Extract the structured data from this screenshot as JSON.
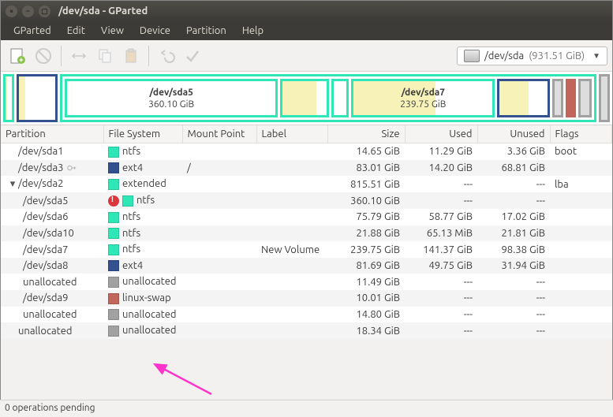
{
  "window": {
    "title": "/dev/sda - GParted"
  },
  "menu": [
    "GParted",
    "Edit",
    "View",
    "Device",
    "Partition",
    "Help"
  ],
  "device_selector": {
    "device": "/dev/sda",
    "size": "(931.51 GiB)"
  },
  "colors": {
    "ntfs": "#2ee6b6",
    "ext4": "#33508f",
    "extended": "#2ee6b6",
    "linux-swap": "#c1665a",
    "unallocated": "#a1a1a1",
    "used_fill": "#f7f2b8"
  },
  "barSegs": {
    "sda5": {
      "label": "/dev/sda5",
      "size": "360.10 GiB"
    },
    "sda7": {
      "label": "/dev/sda7",
      "size": "239.75 GiB"
    }
  },
  "columns": [
    "Partition",
    "File System",
    "Mount Point",
    "Label",
    "Size",
    "Used",
    "Unused",
    "Flags"
  ],
  "rows": [
    {
      "name": "/dev/sda1",
      "key": false,
      "tri": false,
      "warn": false,
      "fs": "ntfs",
      "fscolor": "#2ee6b6",
      "mp": "",
      "label": "",
      "size": "14.65 GiB",
      "used": "11.29 GiB",
      "unused": "3.36 GiB",
      "flags": "boot",
      "indent": 0,
      "alt": false
    },
    {
      "name": "/dev/sda3",
      "key": true,
      "tri": false,
      "warn": false,
      "fs": "ext4",
      "fscolor": "#33508f",
      "mp": "/",
      "label": "",
      "size": "83.01 GiB",
      "used": "14.20 GiB",
      "unused": "68.81 GiB",
      "flags": "",
      "indent": 0,
      "alt": true
    },
    {
      "name": "/dev/sda2",
      "key": false,
      "tri": true,
      "warn": false,
      "fs": "extended",
      "fscolor": "#2ee6b6",
      "mp": "",
      "label": "",
      "size": "815.51 GiB",
      "used": "---",
      "unused": "---",
      "flags": "lba",
      "indent": 0,
      "alt": false
    },
    {
      "name": "/dev/sda5",
      "key": false,
      "tri": false,
      "warn": true,
      "fs": "ntfs",
      "fscolor": "#2ee6b6",
      "mp": "",
      "label": "",
      "size": "360.10 GiB",
      "used": "---",
      "unused": "---",
      "flags": "",
      "indent": 1,
      "alt": true
    },
    {
      "name": "/dev/sda6",
      "key": false,
      "tri": false,
      "warn": false,
      "fs": "ntfs",
      "fscolor": "#2ee6b6",
      "mp": "",
      "label": "",
      "size": "75.79 GiB",
      "used": "58.77 GiB",
      "unused": "17.02 GiB",
      "flags": "",
      "indent": 1,
      "alt": false
    },
    {
      "name": "/dev/sda10",
      "key": false,
      "tri": false,
      "warn": false,
      "fs": "ntfs",
      "fscolor": "#2ee6b6",
      "mp": "",
      "label": "",
      "size": "21.88 GiB",
      "used": "65.13 MiB",
      "unused": "21.81 GiB",
      "flags": "",
      "indent": 1,
      "alt": true
    },
    {
      "name": "/dev/sda7",
      "key": false,
      "tri": false,
      "warn": false,
      "fs": "ntfs",
      "fscolor": "#2ee6b6",
      "mp": "",
      "label": "New Volume",
      "size": "239.75 GiB",
      "used": "141.37 GiB",
      "unused": "98.38 GiB",
      "flags": "",
      "indent": 1,
      "alt": false
    },
    {
      "name": "/dev/sda8",
      "key": false,
      "tri": false,
      "warn": false,
      "fs": "ext4",
      "fscolor": "#33508f",
      "mp": "",
      "label": "",
      "size": "81.69 GiB",
      "used": "49.75 GiB",
      "unused": "31.94 GiB",
      "flags": "",
      "indent": 1,
      "alt": true
    },
    {
      "name": "unallocated",
      "key": false,
      "tri": false,
      "warn": false,
      "fs": "unallocated",
      "fscolor": "#a1a1a1",
      "mp": "",
      "label": "",
      "size": "11.49 GiB",
      "used": "---",
      "unused": "---",
      "flags": "",
      "indent": 1,
      "alt": false
    },
    {
      "name": "/dev/sda9",
      "key": false,
      "tri": false,
      "warn": false,
      "fs": "linux-swap",
      "fscolor": "#c1665a",
      "mp": "",
      "label": "",
      "size": "10.01 GiB",
      "used": "---",
      "unused": "---",
      "flags": "",
      "indent": 1,
      "alt": true
    },
    {
      "name": "unallocated",
      "key": false,
      "tri": false,
      "warn": false,
      "fs": "unallocated",
      "fscolor": "#a1a1a1",
      "mp": "",
      "label": "",
      "size": "14.80 GiB",
      "used": "---",
      "unused": "---",
      "flags": "",
      "indent": 1,
      "alt": false
    },
    {
      "name": "unallocated",
      "key": false,
      "tri": false,
      "warn": false,
      "fs": "unallocated",
      "fscolor": "#a1a1a1",
      "mp": "",
      "label": "",
      "size": "18.34 GiB",
      "used": "---",
      "unused": "---",
      "flags": "",
      "indent": 0,
      "alt": true
    }
  ],
  "status": "0 operations pending"
}
